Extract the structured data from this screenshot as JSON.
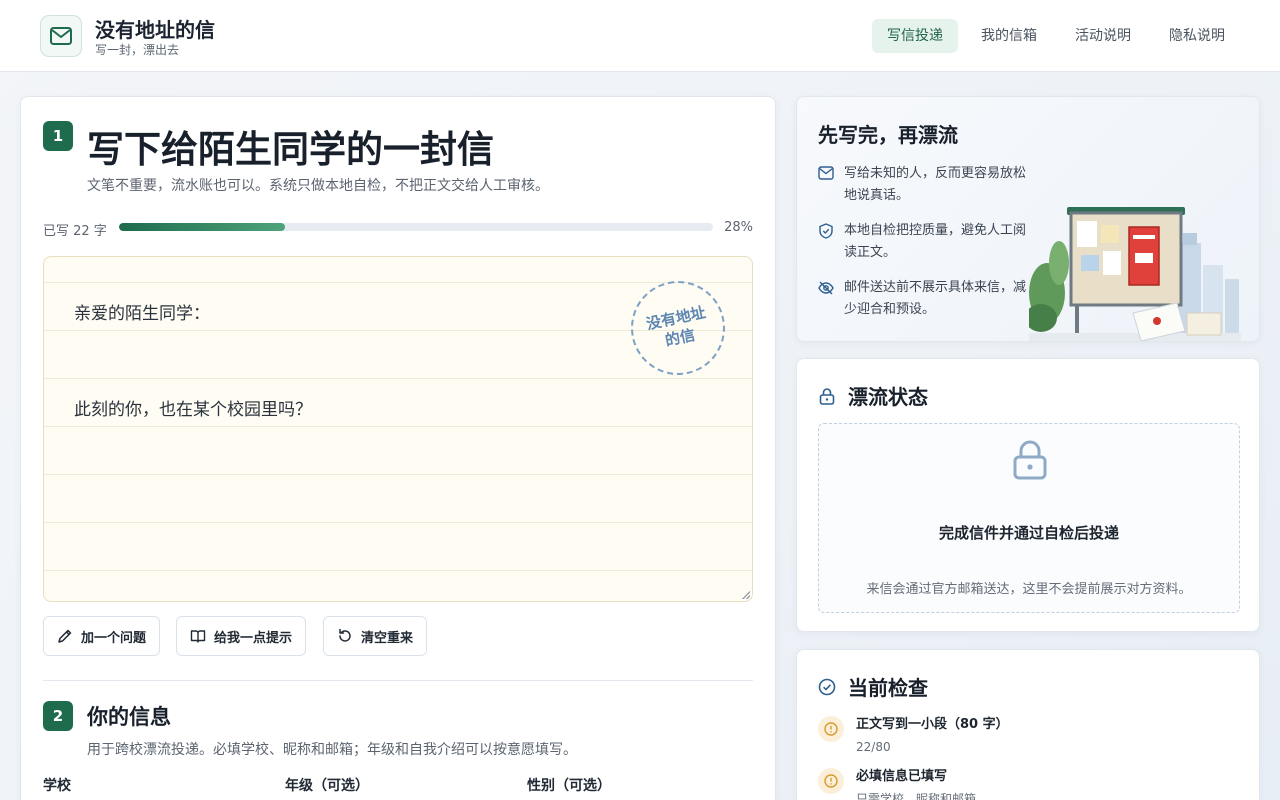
{
  "header": {
    "brand_title": "没有地址的信",
    "brand_subtitle": "写一封，漂出去",
    "nav": [
      "写信投递",
      "我的信箱",
      "活动说明",
      "隐私说明"
    ],
    "active_nav": "写信投递"
  },
  "compose": {
    "step": "1",
    "title": "写下给陌生同学的一封信",
    "subtitle": "文笔不重要，流水账也可以。系统只做本地自检，不把正文交给人工审核。",
    "progress_label": "已写 22 字",
    "progress_percent": "28%",
    "progress_value": 0.28,
    "letter_lines": [
      "亲爱的陌生同学：",
      "此刻的你，也在某个校园里吗？"
    ],
    "stamp_text": "没有地址的信",
    "buttons": {
      "add_question": "加一个问题",
      "give_hint": "给我一点提示",
      "clear": "清空重来"
    }
  },
  "info": {
    "step": "2",
    "title": "你的信息",
    "subtitle": "用于跨校漂流投递。必填学校、昵称和邮箱；年级和自我介绍可以按意愿填写。",
    "fields": [
      "学校",
      "年级（可选）",
      "性别（可选）"
    ]
  },
  "side": {
    "title": "先写完，再漂流",
    "tips": [
      {
        "icon": "mail-icon",
        "text": "写给未知的人，反而更容易放松地说真话。"
      },
      {
        "icon": "shield-check-icon",
        "text": "本地自检把控质量，避免人工阅读正文。"
      },
      {
        "icon": "eye-off-icon",
        "text": "邮件送达前不展示具体来信，减少迎合和预设。"
      }
    ]
  },
  "status": {
    "title": "漂流状态",
    "main": "完成信件并通过自检后投递",
    "sub": "来信会通过官方邮箱送达，这里不会提前展示对方资料。"
  },
  "checks": {
    "title": "当前检查",
    "items": [
      {
        "title": "正文写到一小段（80 字）",
        "sub": "22/80"
      },
      {
        "title": "必填信息已填写",
        "sub": "只需学校、昵称和邮箱"
      }
    ]
  },
  "colors": {
    "accent": "#1f6b4d",
    "warning": "#d99a2b",
    "stamp": "#5d86b3"
  }
}
